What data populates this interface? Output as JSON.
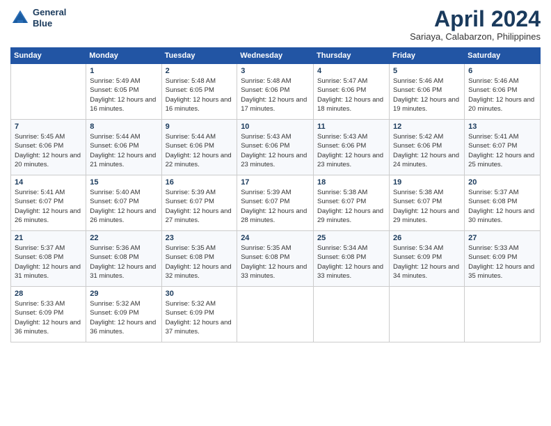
{
  "logo": {
    "line1": "General",
    "line2": "Blue"
  },
  "title": "April 2024",
  "subtitle": "Sariaya, Calabarzon, Philippines",
  "days_of_week": [
    "Sunday",
    "Monday",
    "Tuesday",
    "Wednesday",
    "Thursday",
    "Friday",
    "Saturday"
  ],
  "weeks": [
    [
      {
        "day": "",
        "sunrise": "",
        "sunset": "",
        "daylight": ""
      },
      {
        "day": "1",
        "sunrise": "Sunrise: 5:49 AM",
        "sunset": "Sunset: 6:05 PM",
        "daylight": "Daylight: 12 hours and 16 minutes."
      },
      {
        "day": "2",
        "sunrise": "Sunrise: 5:48 AM",
        "sunset": "Sunset: 6:05 PM",
        "daylight": "Daylight: 12 hours and 16 minutes."
      },
      {
        "day": "3",
        "sunrise": "Sunrise: 5:48 AM",
        "sunset": "Sunset: 6:06 PM",
        "daylight": "Daylight: 12 hours and 17 minutes."
      },
      {
        "day": "4",
        "sunrise": "Sunrise: 5:47 AM",
        "sunset": "Sunset: 6:06 PM",
        "daylight": "Daylight: 12 hours and 18 minutes."
      },
      {
        "day": "5",
        "sunrise": "Sunrise: 5:46 AM",
        "sunset": "Sunset: 6:06 PM",
        "daylight": "Daylight: 12 hours and 19 minutes."
      },
      {
        "day": "6",
        "sunrise": "Sunrise: 5:46 AM",
        "sunset": "Sunset: 6:06 PM",
        "daylight": "Daylight: 12 hours and 20 minutes."
      }
    ],
    [
      {
        "day": "7",
        "sunrise": "Sunrise: 5:45 AM",
        "sunset": "Sunset: 6:06 PM",
        "daylight": "Daylight: 12 hours and 20 minutes."
      },
      {
        "day": "8",
        "sunrise": "Sunrise: 5:44 AM",
        "sunset": "Sunset: 6:06 PM",
        "daylight": "Daylight: 12 hours and 21 minutes."
      },
      {
        "day": "9",
        "sunrise": "Sunrise: 5:44 AM",
        "sunset": "Sunset: 6:06 PM",
        "daylight": "Daylight: 12 hours and 22 minutes."
      },
      {
        "day": "10",
        "sunrise": "Sunrise: 5:43 AM",
        "sunset": "Sunset: 6:06 PM",
        "daylight": "Daylight: 12 hours and 23 minutes."
      },
      {
        "day": "11",
        "sunrise": "Sunrise: 5:43 AM",
        "sunset": "Sunset: 6:06 PM",
        "daylight": "Daylight: 12 hours and 23 minutes."
      },
      {
        "day": "12",
        "sunrise": "Sunrise: 5:42 AM",
        "sunset": "Sunset: 6:06 PM",
        "daylight": "Daylight: 12 hours and 24 minutes."
      },
      {
        "day": "13",
        "sunrise": "Sunrise: 5:41 AM",
        "sunset": "Sunset: 6:07 PM",
        "daylight": "Daylight: 12 hours and 25 minutes."
      }
    ],
    [
      {
        "day": "14",
        "sunrise": "Sunrise: 5:41 AM",
        "sunset": "Sunset: 6:07 PM",
        "daylight": "Daylight: 12 hours and 26 minutes."
      },
      {
        "day": "15",
        "sunrise": "Sunrise: 5:40 AM",
        "sunset": "Sunset: 6:07 PM",
        "daylight": "Daylight: 12 hours and 26 minutes."
      },
      {
        "day": "16",
        "sunrise": "Sunrise: 5:39 AM",
        "sunset": "Sunset: 6:07 PM",
        "daylight": "Daylight: 12 hours and 27 minutes."
      },
      {
        "day": "17",
        "sunrise": "Sunrise: 5:39 AM",
        "sunset": "Sunset: 6:07 PM",
        "daylight": "Daylight: 12 hours and 28 minutes."
      },
      {
        "day": "18",
        "sunrise": "Sunrise: 5:38 AM",
        "sunset": "Sunset: 6:07 PM",
        "daylight": "Daylight: 12 hours and 29 minutes."
      },
      {
        "day": "19",
        "sunrise": "Sunrise: 5:38 AM",
        "sunset": "Sunset: 6:07 PM",
        "daylight": "Daylight: 12 hours and 29 minutes."
      },
      {
        "day": "20",
        "sunrise": "Sunrise: 5:37 AM",
        "sunset": "Sunset: 6:08 PM",
        "daylight": "Daylight: 12 hours and 30 minutes."
      }
    ],
    [
      {
        "day": "21",
        "sunrise": "Sunrise: 5:37 AM",
        "sunset": "Sunset: 6:08 PM",
        "daylight": "Daylight: 12 hours and 31 minutes."
      },
      {
        "day": "22",
        "sunrise": "Sunrise: 5:36 AM",
        "sunset": "Sunset: 6:08 PM",
        "daylight": "Daylight: 12 hours and 31 minutes."
      },
      {
        "day": "23",
        "sunrise": "Sunrise: 5:35 AM",
        "sunset": "Sunset: 6:08 PM",
        "daylight": "Daylight: 12 hours and 32 minutes."
      },
      {
        "day": "24",
        "sunrise": "Sunrise: 5:35 AM",
        "sunset": "Sunset: 6:08 PM",
        "daylight": "Daylight: 12 hours and 33 minutes."
      },
      {
        "day": "25",
        "sunrise": "Sunrise: 5:34 AM",
        "sunset": "Sunset: 6:08 PM",
        "daylight": "Daylight: 12 hours and 33 minutes."
      },
      {
        "day": "26",
        "sunrise": "Sunrise: 5:34 AM",
        "sunset": "Sunset: 6:09 PM",
        "daylight": "Daylight: 12 hours and 34 minutes."
      },
      {
        "day": "27",
        "sunrise": "Sunrise: 5:33 AM",
        "sunset": "Sunset: 6:09 PM",
        "daylight": "Daylight: 12 hours and 35 minutes."
      }
    ],
    [
      {
        "day": "28",
        "sunrise": "Sunrise: 5:33 AM",
        "sunset": "Sunset: 6:09 PM",
        "daylight": "Daylight: 12 hours and 36 minutes."
      },
      {
        "day": "29",
        "sunrise": "Sunrise: 5:32 AM",
        "sunset": "Sunset: 6:09 PM",
        "daylight": "Daylight: 12 hours and 36 minutes."
      },
      {
        "day": "30",
        "sunrise": "Sunrise: 5:32 AM",
        "sunset": "Sunset: 6:09 PM",
        "daylight": "Daylight: 12 hours and 37 minutes."
      },
      {
        "day": "",
        "sunrise": "",
        "sunset": "",
        "daylight": ""
      },
      {
        "day": "",
        "sunrise": "",
        "sunset": "",
        "daylight": ""
      },
      {
        "day": "",
        "sunrise": "",
        "sunset": "",
        "daylight": ""
      },
      {
        "day": "",
        "sunrise": "",
        "sunset": "",
        "daylight": ""
      }
    ]
  ]
}
